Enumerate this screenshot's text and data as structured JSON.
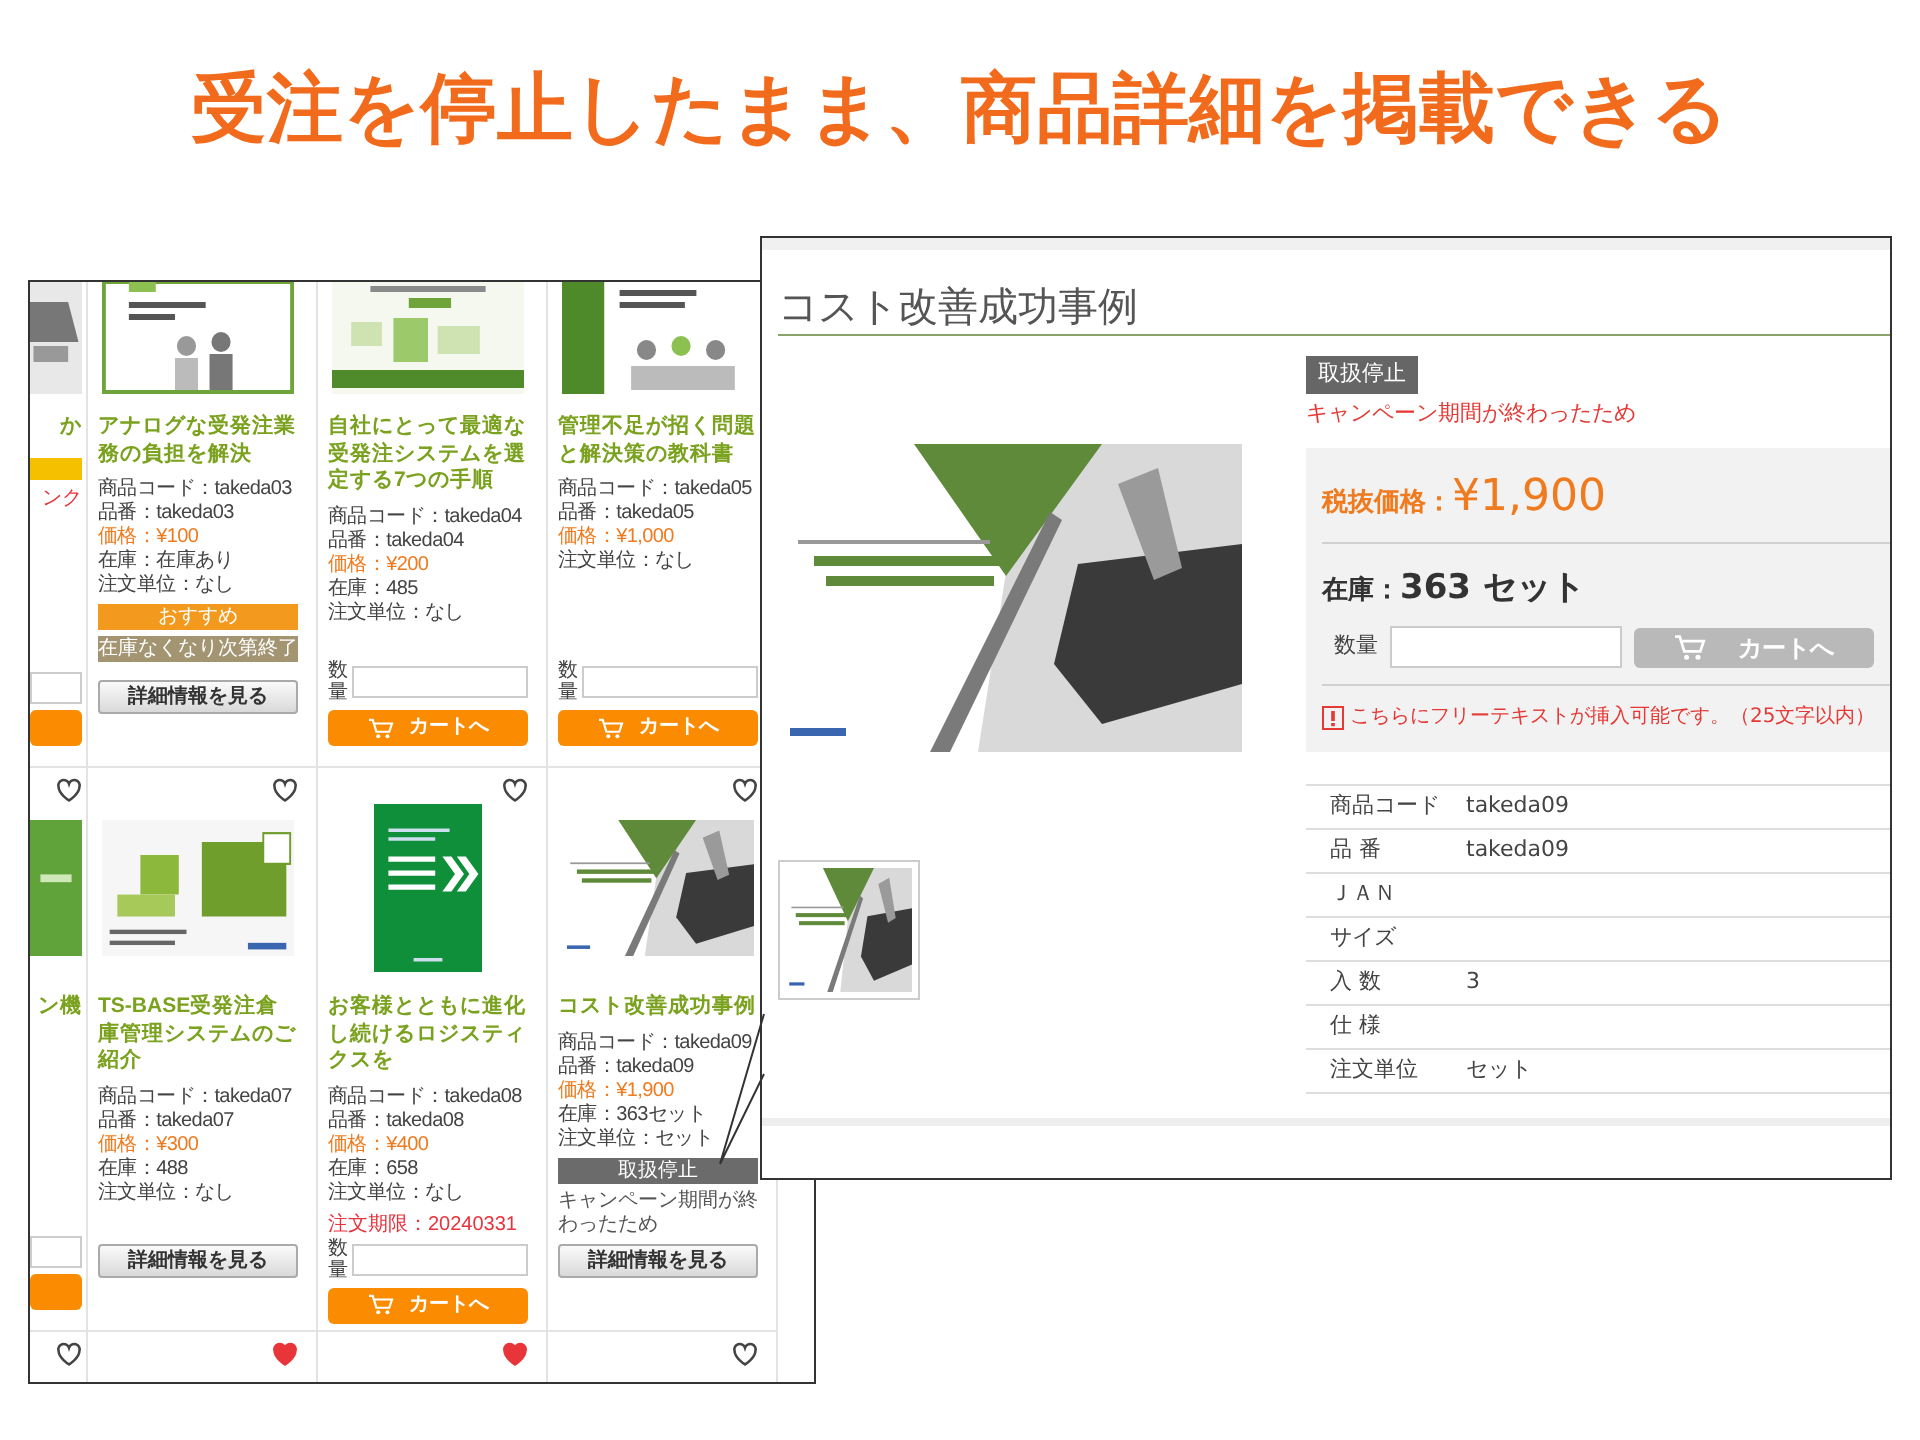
{
  "headline": "受注を停止したまま、商品詳細を掲載できる",
  "product_list": {
    "rows": [
      {
        "cards": [
          {
            "kind": "partial",
            "title": "か",
            "badges": [
              {
                "color": "#f5c000"
              }
            ],
            "note": {
              "kind": "alert",
              "text": "ンク"
            }
          },
          {
            "kind": "product",
            "title": "アナログな受発注業務の負担を解決",
            "details": [
              {
                "kind": "plain",
                "text": "商品コード：takeda03"
              },
              {
                "kind": "plain",
                "text": "品番：takeda03"
              },
              {
                "kind": "price",
                "text": "価格：¥100"
              },
              {
                "kind": "plain",
                "text": "在庫：在庫あり"
              },
              {
                "kind": "plain",
                "text": "注文単位：なし"
              }
            ],
            "badges": [
              {
                "text": "おすすめ",
                "color": "#f39a1e"
              },
              {
                "text": "在庫なくなり次第終了",
                "color": "#a39472"
              }
            ],
            "detail_label": "詳細情報を見る"
          },
          {
            "kind": "product",
            "title": "自社にとって最適な受発注システムを選定する7つの手順",
            "details": [
              {
                "kind": "plain",
                "text": "商品コード：takeda04"
              },
              {
                "kind": "plain",
                "text": "品番：takeda04"
              },
              {
                "kind": "price",
                "text": "価格：¥200"
              },
              {
                "kind": "plain",
                "text": "在庫：485"
              },
              {
                "kind": "plain",
                "text": "注文単位：なし"
              }
            ],
            "quantity_label": "数量",
            "cart_label": "カートへ"
          },
          {
            "kind": "product",
            "title": "管理不足が招く問題と解決策の教科書",
            "details": [
              {
                "kind": "plain",
                "text": "商品コード：takeda05"
              },
              {
                "kind": "plain",
                "text": "品番：takeda05"
              },
              {
                "kind": "price",
                "text": "価格：¥1,000"
              },
              {
                "kind": "plain",
                "text": "注文単位：なし"
              }
            ],
            "quantity_label": "数量",
            "cart_label": "カートへ"
          }
        ]
      },
      {
        "cards": [
          {
            "kind": "partial",
            "favorite": false,
            "title": "ン機"
          },
          {
            "kind": "product",
            "favorite": false,
            "title": "TS-BASE受発注倉庫管理システムのご紹介",
            "details": [
              {
                "kind": "plain",
                "text": "商品コード：takeda07"
              },
              {
                "kind": "plain",
                "text": "品番：takeda07"
              },
              {
                "kind": "price",
                "text": "価格：¥300"
              },
              {
                "kind": "plain",
                "text": "在庫：488"
              },
              {
                "kind": "plain",
                "text": "注文単位：なし"
              }
            ],
            "detail_label": "詳細情報を見る"
          },
          {
            "kind": "product",
            "favorite": false,
            "title": "お客様とともに進化し続けるロジスティクスを",
            "details": [
              {
                "kind": "plain",
                "text": "商品コード：takeda08"
              },
              {
                "kind": "plain",
                "text": "品番：takeda08"
              },
              {
                "kind": "price",
                "text": "価格：¥400"
              },
              {
                "kind": "plain",
                "text": "在庫：658"
              },
              {
                "kind": "plain",
                "text": "注文単位：なし"
              }
            ],
            "note": {
              "kind": "alert",
              "text": "注文期限：20240331"
            },
            "quantity_label": "数量",
            "cart_label": "カートへ"
          },
          {
            "kind": "product",
            "favorite": false,
            "title": "コスト改善成功事例",
            "details": [
              {
                "kind": "plain",
                "text": "商品コード：takeda09"
              },
              {
                "kind": "plain",
                "text": "品番：takeda09"
              },
              {
                "kind": "price",
                "text": "価格：¥1,900"
              },
              {
                "kind": "plain",
                "text": "在庫：363セット"
              },
              {
                "kind": "plain",
                "text": "注文単位：セット"
              }
            ],
            "badges": [
              {
                "text": "取扱停止",
                "color": "#6b6b6b"
              }
            ],
            "note": {
              "kind": "info",
              "text": "キャンペーン期間が終わったため"
            },
            "detail_label": "詳細情報を見る"
          }
        ]
      },
      {
        "cards": [
          {
            "kind": "partial",
            "favorite": false
          },
          {
            "kind": "product",
            "favorite": true
          },
          {
            "kind": "product",
            "favorite": true
          },
          {
            "kind": "product",
            "favorite": false
          }
        ]
      }
    ]
  },
  "detail_page": {
    "title": "コスト改善成功事例",
    "status_badge": "取扱停止",
    "status_reason": "キャンペーン期間が終わったため",
    "price_label": "税抜価格：",
    "price": "¥1,900",
    "stock_label": "在庫：",
    "stock": "363 セット",
    "quantity_label": "数量",
    "cart_button": {
      "label": "カートへ",
      "disabled": true
    },
    "free_text": "こちらにフリーテキストが挿入可能です。（25文字以内）",
    "specs": [
      {
        "label": "商品コード",
        "value": "takeda09"
      },
      {
        "label": "品 番",
        "value": "takeda09"
      },
      {
        "label": "ＪＡＮ"
      },
      {
        "label": "サイズ"
      },
      {
        "label": "入 数",
        "value": "3"
      },
      {
        "label": "仕 様"
      },
      {
        "label": "注文単位",
        "value": "セット"
      }
    ]
  }
}
